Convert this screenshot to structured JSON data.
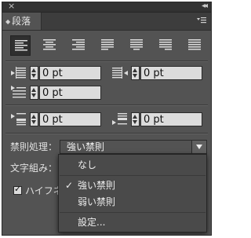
{
  "window": {
    "close_glyph": "×",
    "collapse_glyph": "◂◂"
  },
  "tab": {
    "label": "段落"
  },
  "indent": {
    "left": "0 pt",
    "right": "0 pt",
    "first_line": "0 pt",
    "space_before": "0 pt",
    "space_after": "0 pt"
  },
  "kinsoku": {
    "label": "禁則処理：",
    "value": "強い禁則"
  },
  "mojikumi": {
    "label": "文字組み："
  },
  "hyphenate": {
    "label": "ハイフネ"
  },
  "menu": {
    "items": [
      {
        "label": "なし",
        "checked": false
      },
      {
        "label": "強い禁則",
        "checked": true
      },
      {
        "label": "弱い禁則",
        "checked": false
      },
      {
        "label": "設定...",
        "checked": false
      }
    ],
    "check_glyph": "✓"
  },
  "colors": {
    "panel_bg": "#535353",
    "field_bg": "#dcdcdc",
    "menu_bg": "#4a4a4a"
  }
}
